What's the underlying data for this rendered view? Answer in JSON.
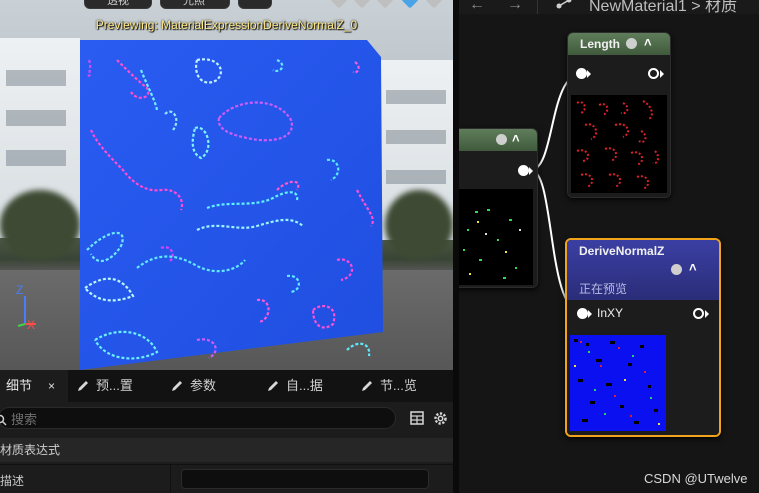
{
  "viewport": {
    "toolbar": {
      "btn_1": "透视",
      "btn_2": "光照"
    },
    "preview_label": "Previewing: MaterialExpressionDeriveNormalZ_0",
    "axis": {
      "z": "Z",
      "x": "X"
    }
  },
  "details_panel": {
    "tabs": [
      {
        "label": "细节",
        "close": "×"
      },
      {
        "label": "预...置"
      },
      {
        "label": "参数"
      },
      {
        "label": "自...据"
      },
      {
        "label": "节...览"
      }
    ],
    "search": {
      "placeholder": "搜索"
    },
    "section_title": "材质表达式",
    "properties": [
      {
        "label": "描述",
        "value": ""
      }
    ]
  },
  "graph": {
    "breadcrumb": "NewMaterial1 > 材质",
    "nodes": {
      "length": {
        "title": "Length"
      },
      "derive": {
        "title": "DeriveNormalZ",
        "subtitle": "正在预览",
        "input_pin": "InXY"
      }
    }
  },
  "colors": {
    "accent_orange": "#f2a31c",
    "preview_label": "#ffe989",
    "length_header": "#5f7d5a",
    "derive_header": "#3b3fa3"
  },
  "watermark": "CSDN @UTwelve"
}
